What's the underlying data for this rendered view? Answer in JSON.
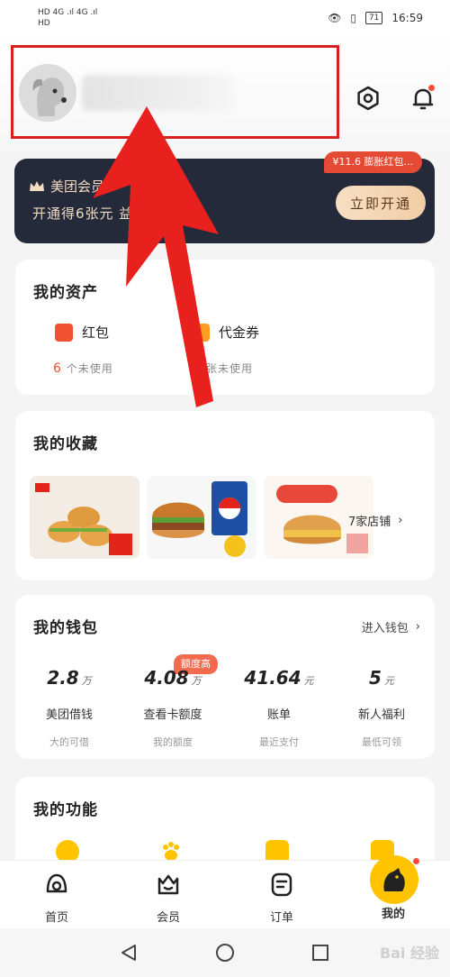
{
  "status_bar": {
    "left_top": "HD 4G .ıl 4G .ıl",
    "left_bottom": "HD",
    "battery": "71",
    "time": "16:59"
  },
  "member": {
    "title": "美团会员",
    "subtitle": "开通得6张元 益 红包",
    "button": "立即开通",
    "tip": "¥11.6 膨胀红包..."
  },
  "assets": {
    "title": "我的资产",
    "items": [
      {
        "label": "红包",
        "count": "6",
        "sub": "个未使用",
        "color": "#f0502e"
      },
      {
        "label": "代金券",
        "count": "",
        "sub": "张未使用",
        "color": "#ff9d1f"
      }
    ]
  },
  "favorites": {
    "title": "我的收藏",
    "more": "7家店铺",
    "chevron": "›"
  },
  "wallet": {
    "title": "我的钱包",
    "link": "进入钱包",
    "link_chevron": "›",
    "tag": "额度高",
    "items": [
      {
        "value": "2.8",
        "unit": "万",
        "label": "美团借钱",
        "sub": "大的可借"
      },
      {
        "value": "4.08",
        "unit": "万",
        "label": "查看卡额度",
        "sub": "我的额度"
      },
      {
        "value": "41.64",
        "unit": "元",
        "label": "账单",
        "sub": "最近支付"
      },
      {
        "value": "5",
        "unit": "元",
        "label": "新人福利",
        "sub": "最低可领"
      }
    ]
  },
  "functions": {
    "title": "我的功能"
  },
  "tabbar": {
    "items": [
      {
        "label": "首页"
      },
      {
        "label": "会员"
      },
      {
        "label": "订单"
      },
      {
        "label": "我的"
      }
    ]
  },
  "watermark": "Bai 经验",
  "colors": {
    "accent": "#ffc300",
    "annotation": "#e8201e",
    "member_bg": "#242a3a"
  }
}
